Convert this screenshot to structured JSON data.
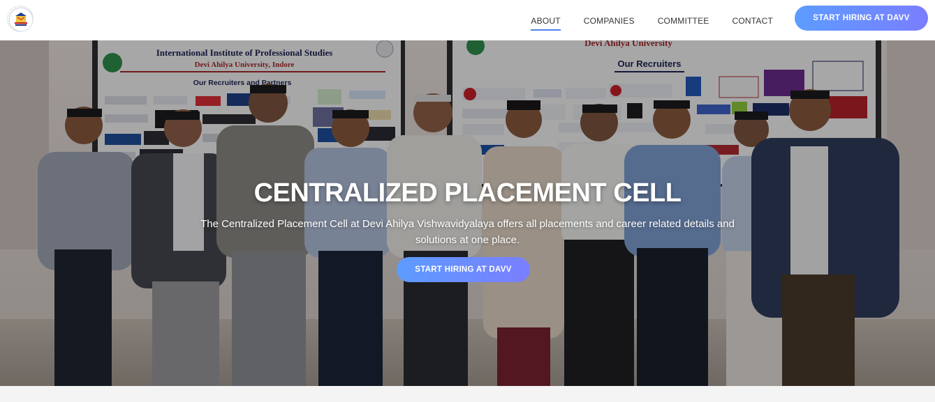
{
  "navbar": {
    "links": [
      {
        "label": "ABOUT",
        "active": true
      },
      {
        "label": "COMPANIES",
        "active": false
      },
      {
        "label": "COMMITTEE",
        "active": false
      },
      {
        "label": "CONTACT",
        "active": false
      }
    ],
    "cta_label": "START HIRING AT DAVV"
  },
  "hero": {
    "title": "CENTRALIZED PLACEMENT CELL",
    "description": "The Centralized Placement Cell at Devi Ahilya Vishwavidyalaya offers all placements and career related details and solutions at one place.",
    "cta_label": "START HIRING AT DAVV",
    "banner_left": {
      "heading": "International Institute of Professional Studies",
      "subheading": "Devi Ahilya University, Indore",
      "section": "Our Recruiters and Partners"
    },
    "banner_right": {
      "heading": "Devi Ahilya University",
      "section": "Our Recruiters"
    }
  },
  "colors": {
    "accent_start": "#5d9cff",
    "accent_end": "#7a7eff",
    "active_underline": "#4d82f0"
  }
}
